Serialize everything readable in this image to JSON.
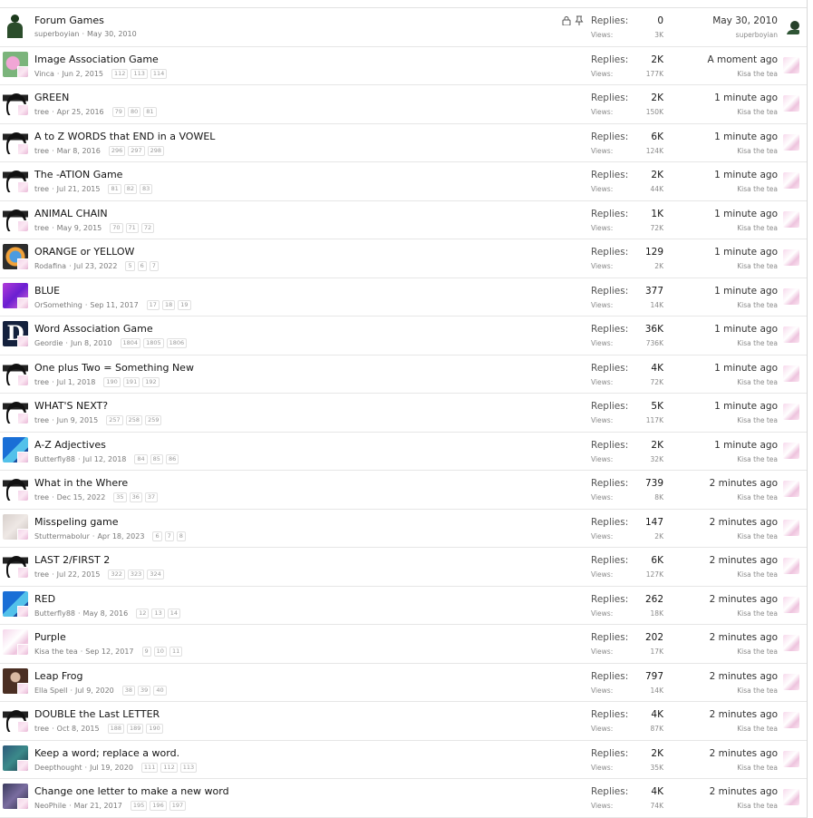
{
  "labels": {
    "replies": "Replies:",
    "views": "Views:"
  },
  "threads": [
    {
      "title": "Forum Games",
      "author": "superboyian",
      "date": "May 30, 2010",
      "pages": [],
      "replies": "0",
      "views": "3K",
      "last_when": "May 30, 2010",
      "last_user": "superboyian",
      "avatar": "man",
      "locked": true,
      "pinned": true,
      "last_avatar": "green"
    },
    {
      "title": "Image Association Game",
      "author": "Vinca",
      "date": "Jun 2, 2015",
      "pages": [
        "112",
        "113",
        "114"
      ],
      "replies": "2K",
      "views": "177K",
      "last_when": "A moment ago",
      "last_user": "Kisa the tea",
      "avatar": "flower"
    },
    {
      "title": "GREEN",
      "author": "tree",
      "date": "Apr 25, 2016",
      "pages": [
        "79",
        "80",
        "81"
      ],
      "replies": "2K",
      "views": "150K",
      "last_when": "1 minute ago",
      "last_user": "Kisa the tea",
      "avatar": "face"
    },
    {
      "title": "A to Z WORDS that END in a VOWEL",
      "author": "tree",
      "date": "Mar 8, 2016",
      "pages": [
        "296",
        "297",
        "298"
      ],
      "replies": "6K",
      "views": "124K",
      "last_when": "1 minute ago",
      "last_user": "Kisa the tea",
      "avatar": "face"
    },
    {
      "title": "The -ATION Game",
      "author": "tree",
      "date": "Jul 21, 2015",
      "pages": [
        "81",
        "82",
        "83"
      ],
      "replies": "2K",
      "views": "44K",
      "last_when": "1 minute ago",
      "last_user": "Kisa the tea",
      "avatar": "face"
    },
    {
      "title": "ANIMAL CHAIN",
      "author": "tree",
      "date": "May 9, 2015",
      "pages": [
        "70",
        "71",
        "72"
      ],
      "replies": "1K",
      "views": "72K",
      "last_when": "1 minute ago",
      "last_user": "Kisa the tea",
      "avatar": "face"
    },
    {
      "title": "ORANGE or YELLOW",
      "author": "Rodafina",
      "date": "Jul 23, 2022",
      "pages": [
        "5",
        "6",
        "7"
      ],
      "replies": "129",
      "views": "2K",
      "last_when": "1 minute ago",
      "last_user": "Kisa the tea",
      "avatar": "orange"
    },
    {
      "title": "BLUE",
      "author": "OrSomething",
      "date": "Sep 11, 2017",
      "pages": [
        "17",
        "18",
        "19"
      ],
      "replies": "377",
      "views": "14K",
      "last_when": "1 minute ago",
      "last_user": "Kisa the tea",
      "avatar": "blue"
    },
    {
      "title": "Word Association Game",
      "author": "Geordie",
      "date": "Jun 8, 2010",
      "pages": [
        "1804",
        "1805",
        "1806"
      ],
      "replies": "36K",
      "views": "736K",
      "last_when": "1 minute ago",
      "last_user": "Kisa the tea",
      "avatar": "d",
      "avatar_letter": "D"
    },
    {
      "title": "One plus Two = Something New",
      "author": "tree",
      "date": "Jul 1, 2018",
      "pages": [
        "190",
        "191",
        "192"
      ],
      "replies": "4K",
      "views": "72K",
      "last_when": "1 minute ago",
      "last_user": "Kisa the tea",
      "avatar": "face"
    },
    {
      "title": "WHAT'S NEXT?",
      "author": "tree",
      "date": "Jun 9, 2015",
      "pages": [
        "257",
        "258",
        "259"
      ],
      "replies": "5K",
      "views": "117K",
      "last_when": "1 minute ago",
      "last_user": "Kisa the tea",
      "avatar": "face"
    },
    {
      "title": "A-Z Adjectives",
      "author": "Butterfly88",
      "date": "Jul 12, 2018",
      "pages": [
        "84",
        "85",
        "86"
      ],
      "replies": "2K",
      "views": "32K",
      "last_when": "1 minute ago",
      "last_user": "Kisa the tea",
      "avatar": "butterfly"
    },
    {
      "title": "What in the Where",
      "author": "tree",
      "date": "Dec 15, 2022",
      "pages": [
        "35",
        "36",
        "37"
      ],
      "replies": "739",
      "views": "8K",
      "last_when": "2 minutes ago",
      "last_user": "Kisa the tea",
      "avatar": "face"
    },
    {
      "title": "Misspeling game",
      "author": "Stuttermabolur",
      "date": "Apr 18, 2023",
      "pages": [
        "6",
        "7",
        "8"
      ],
      "replies": "147",
      "views": "2K",
      "last_when": "2 minutes ago",
      "last_user": "Kisa the tea",
      "avatar": "pale"
    },
    {
      "title": "LAST 2/FIRST 2",
      "author": "tree",
      "date": "Jul 22, 2015",
      "pages": [
        "322",
        "323",
        "324"
      ],
      "replies": "6K",
      "views": "127K",
      "last_when": "2 minutes ago",
      "last_user": "Kisa the tea",
      "avatar": "face"
    },
    {
      "title": "RED",
      "author": "Butterfly88",
      "date": "May 8, 2016",
      "pages": [
        "12",
        "13",
        "14"
      ],
      "replies": "262",
      "views": "18K",
      "last_when": "2 minutes ago",
      "last_user": "Kisa the tea",
      "avatar": "butterfly"
    },
    {
      "title": "Purple",
      "author": "Kisa the tea",
      "date": "Sep 12, 2017",
      "pages": [
        "9",
        "10",
        "11"
      ],
      "replies": "202",
      "views": "17K",
      "last_when": "2 minutes ago",
      "last_user": "Kisa the tea",
      "avatar": "kisa"
    },
    {
      "title": "Leap Frog",
      "author": "Ella Spell",
      "date": "Jul 9, 2020",
      "pages": [
        "38",
        "39",
        "40"
      ],
      "replies": "797",
      "views": "14K",
      "last_when": "2 minutes ago",
      "last_user": "Kisa the tea",
      "avatar": "brown"
    },
    {
      "title": "DOUBLE the Last LETTER",
      "author": "tree",
      "date": "Oct 8, 2015",
      "pages": [
        "188",
        "189",
        "190"
      ],
      "replies": "4K",
      "views": "87K",
      "last_when": "2 minutes ago",
      "last_user": "Kisa the tea",
      "avatar": "face"
    },
    {
      "title": "Keep a word; replace a word.",
      "author": "Deepthought",
      "date": "Jul 19, 2020",
      "pages": [
        "111",
        "112",
        "113"
      ],
      "replies": "2K",
      "views": "35K",
      "last_when": "2 minutes ago",
      "last_user": "Kisa the tea",
      "avatar": "teal"
    },
    {
      "title": "Change one letter to make a new word",
      "author": "NeoPhile",
      "date": "Mar 21, 2017",
      "pages": [
        "195",
        "196",
        "197"
      ],
      "replies": "4K",
      "views": "74K",
      "last_when": "2 minutes ago",
      "last_user": "Kisa the tea",
      "avatar": "neo"
    }
  ]
}
